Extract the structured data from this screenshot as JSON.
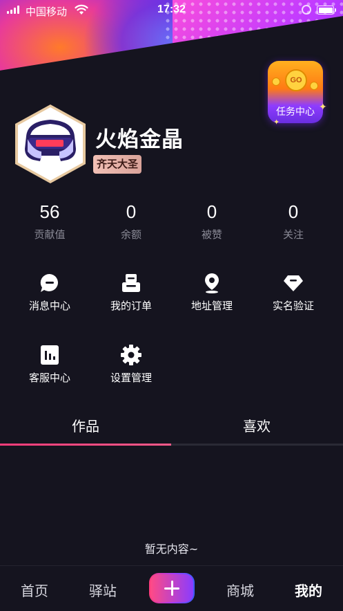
{
  "status_bar": {
    "carrier": "中国移动",
    "time": "17:32"
  },
  "task_center": {
    "label": "任务中心",
    "coin_text": "GO"
  },
  "profile": {
    "name": "火焰金晶",
    "badge": "齐天大圣"
  },
  "stats": [
    {
      "value": "56",
      "label": "贡献值"
    },
    {
      "value": "0",
      "label": "余额"
    },
    {
      "value": "0",
      "label": "被赞"
    },
    {
      "value": "0",
      "label": "关注"
    }
  ],
  "menu": [
    {
      "label": "消息中心",
      "icon": "message-icon"
    },
    {
      "label": "我的订单",
      "icon": "order-icon"
    },
    {
      "label": "地址管理",
      "icon": "location-icon"
    },
    {
      "label": "实名验证",
      "icon": "diamond-icon"
    },
    {
      "label": "客服中心",
      "icon": "service-chart-icon"
    },
    {
      "label": "设置管理",
      "icon": "gear-icon"
    }
  ],
  "tabs": [
    {
      "label": "作品"
    },
    {
      "label": "喜欢"
    }
  ],
  "active_tab": 0,
  "empty_text": "暂无内容~",
  "bottom_nav": [
    {
      "label": "首页"
    },
    {
      "label": "驿站"
    },
    {
      "label": "商城"
    },
    {
      "label": "我的"
    }
  ],
  "active_nav": 3,
  "colors": {
    "background": "#15141f",
    "accent": "#ff3c7a",
    "muted_text": "#8a8a96"
  }
}
